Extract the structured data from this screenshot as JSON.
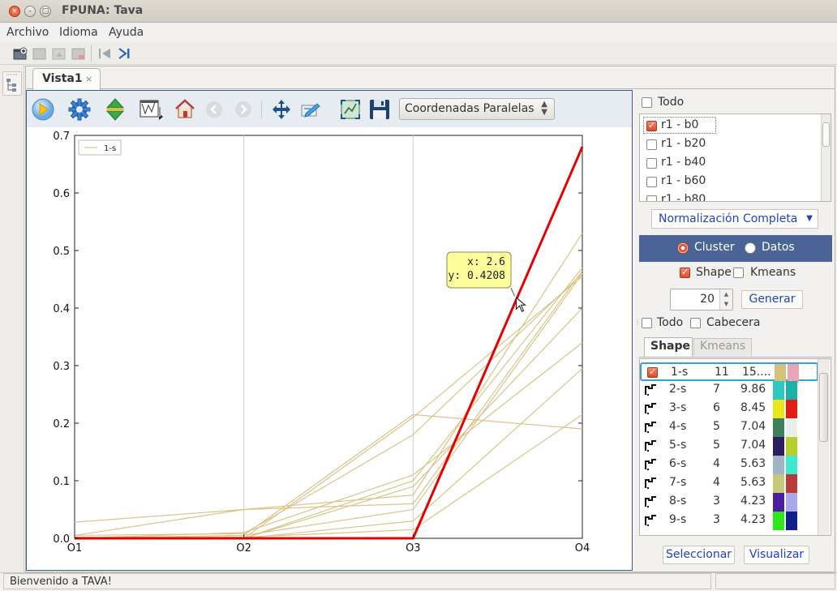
{
  "window": {
    "title": "FPUNA: Tava",
    "close_glyph": "×",
    "min_glyph": "–",
    "max_glyph": "□"
  },
  "menubar": {
    "items": [
      "Archivo",
      "Idioma",
      "Ayuda"
    ]
  },
  "tabs": [
    {
      "label": "Vista1",
      "close_glyph": "×"
    }
  ],
  "plot_toolbar": {
    "icons": [
      "play-icon",
      "settings-gear-icon",
      "up-down-arrows-icon",
      "chart-export-icon",
      "home-icon",
      "back-arrow-icon",
      "forward-arrow-icon",
      "pan-move-icon",
      "edit-axes-icon",
      "zoom-fit-icon",
      "save-floppy-icon"
    ],
    "view_select": {
      "value": "Coordenadas Paralelas"
    }
  },
  "chart_data": {
    "type": "line",
    "categories": [
      "O1",
      "O2",
      "O3",
      "O4"
    ],
    "ylim": [
      0.0,
      0.7
    ],
    "yticks": [
      "0.0",
      "0.1",
      "0.2",
      "0.3",
      "0.4",
      "0.5",
      "0.6",
      "0.7"
    ],
    "legend": {
      "entries": [
        "1-s"
      ],
      "placement": "top-left"
    },
    "grid": "vertical",
    "highlight": {
      "name": "1-s",
      "color": "#e60000",
      "values": [
        0.0,
        0.0,
        0.0,
        0.68
      ]
    },
    "series_color": "#d9c489",
    "series": [
      {
        "values": [
          0.028,
          0.05,
          0.075,
          0.53
        ]
      },
      {
        "values": [
          0.005,
          0.05,
          0.06,
          0.465
        ]
      },
      {
        "values": [
          0.0,
          0.005,
          0.215,
          0.19
        ]
      },
      {
        "values": [
          0.005,
          0.008,
          0.18,
          0.46
        ]
      },
      {
        "values": [
          0.0,
          0.01,
          0.11,
          0.34
        ]
      },
      {
        "values": [
          0.0,
          0.0,
          0.09,
          0.4
        ]
      },
      {
        "values": [
          0.0,
          0.005,
          0.05,
          0.46
        ]
      },
      {
        "values": [
          0.0,
          0.002,
          0.015,
          0.215
        ]
      },
      {
        "values": [
          0.002,
          0.0,
          0.03,
          0.295
        ]
      },
      {
        "values": [
          0.0,
          0.0,
          0.21,
          0.455
        ]
      },
      {
        "values": [
          0.0,
          0.0,
          0.1,
          0.47
        ]
      }
    ],
    "tooltip": {
      "x_label": "x: 2.6",
      "y_label": "y: 0.4208",
      "x": 2.6,
      "y": 0.4208
    }
  },
  "right_panel": {
    "todo_top": {
      "label": "Todo",
      "checked": false
    },
    "bundles": [
      {
        "label": "r1 - b0",
        "checked": true
      },
      {
        "label": "r1 - b20",
        "checked": false
      },
      {
        "label": "r1 - b40",
        "checked": false
      },
      {
        "label": "r1 - b60",
        "checked": false
      },
      {
        "label": "r1 - b80",
        "checked": false
      }
    ],
    "normalization": "Normalización Completa",
    "radio_cluster": "Cluster",
    "radio_datos": "Datos",
    "shape_label": "Shape",
    "kmeans_label": "Kmeans",
    "count_value": "20",
    "generate_button": "Generar",
    "todo_bottom": "Todo",
    "cabecera": "Cabecera",
    "tab_shape": "Shape",
    "tab_kmeans": "Kmeans",
    "shapes": [
      {
        "name": "1-s",
        "count": "11",
        "pct": "15....",
        "c1": "#d6c07a",
        "c2": "#e8a6b6",
        "checked": true
      },
      {
        "name": "2-s",
        "count": "7",
        "pct": "9.86",
        "c1": "#2ec7c0",
        "c2": "#1ab2a8"
      },
      {
        "name": "3-s",
        "count": "6",
        "pct": "8.45",
        "c1": "#e8e81a",
        "c2": "#e61c12"
      },
      {
        "name": "4-s",
        "count": "5",
        "pct": "7.04",
        "c1": "#3f7f5a",
        "c2": "#e8efe8"
      },
      {
        "name": "5-s",
        "count": "5",
        "pct": "7.04",
        "c1": "#2c1e5c",
        "c2": "#b8cf2a"
      },
      {
        "name": "6-s",
        "count": "4",
        "pct": "5.63",
        "c1": "#9fb6c8",
        "c2": "#3fe8d0"
      },
      {
        "name": "7-s",
        "count": "4",
        "pct": "5.63",
        "c1": "#c8c87a",
        "c2": "#b83a3a"
      },
      {
        "name": "8-s",
        "count": "3",
        "pct": "4.23",
        "c1": "#4a1e9e",
        "c2": "#a8a8ee"
      },
      {
        "name": "9-s",
        "count": "3",
        "pct": "4.23",
        "c1": "#2ee81a",
        "c2": "#12208e"
      }
    ],
    "select_button": "Seleccionar",
    "visualize_button": "Visualizar"
  },
  "status": {
    "message": "Bienvenido a TAVA!"
  },
  "colors": {
    "accent": "#4a6498",
    "link_blue": "#2343b8",
    "highlight_red": "#e60000"
  }
}
